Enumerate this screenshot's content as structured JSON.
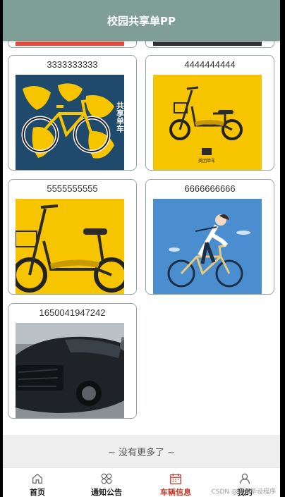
{
  "header": {
    "title": "校园共享单PP"
  },
  "cards": [
    {
      "label": "3333333333",
      "image": "bike-world-map",
      "image_text": "共享单车"
    },
    {
      "label": "4444444444",
      "image": "yellow-scooter",
      "image_text": "美团单车"
    },
    {
      "label": "5555555555",
      "image": "yellow-scooter-closeup"
    },
    {
      "label": "6666666666",
      "image": "cyclist-illustration"
    },
    {
      "label": "1650041947242",
      "image": "black-car"
    }
  ],
  "list_footer": "~ 没有更多了 ~",
  "tabbar": {
    "items": [
      {
        "label": "首页",
        "icon": "home-icon"
      },
      {
        "label": "通知公告",
        "icon": "grid-icon"
      },
      {
        "label": "车辆信息",
        "icon": "calendar-icon",
        "active": true
      },
      {
        "label": "我的",
        "icon": "user-icon"
      }
    ]
  },
  "watermark": "CSDN @计同毕设程序",
  "colors": {
    "header": "#7f9e95",
    "active_tab": "#c0392b",
    "accent_yellow": "#f7c400"
  }
}
